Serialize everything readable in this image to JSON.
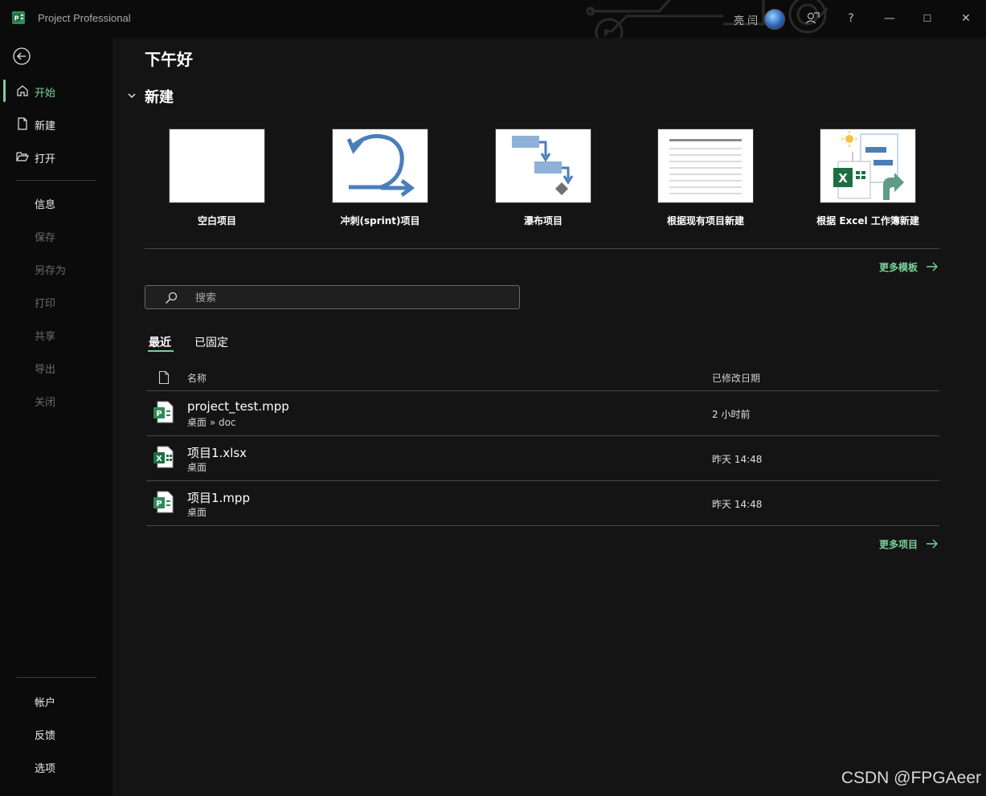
{
  "window": {
    "app_title": "Project Professional",
    "user_name": "亮 闫",
    "help_label": "?",
    "minimize_glyph": "—",
    "maximize_glyph": "☐",
    "close_glyph": "✕"
  },
  "sidebar": {
    "back_icon": "back-arrow-icon",
    "top_items": [
      {
        "label": "开始",
        "icon": "home-icon",
        "active": true
      },
      {
        "label": "新建",
        "icon": "new-document-icon"
      },
      {
        "label": "打开",
        "icon": "open-folder-icon"
      }
    ],
    "mid_items": [
      {
        "label": "信息"
      },
      {
        "label": "保存",
        "disabled": true
      },
      {
        "label": "另存为",
        "disabled": true
      },
      {
        "label": "打印",
        "disabled": true
      },
      {
        "label": "共享",
        "disabled": true
      },
      {
        "label": "导出",
        "disabled": true
      },
      {
        "label": "关闭",
        "disabled": true
      }
    ],
    "bottom_items": [
      {
        "label": "帐户"
      },
      {
        "label": "反馈"
      },
      {
        "label": "选项"
      }
    ]
  },
  "main": {
    "greeting": "下午好",
    "new_section": {
      "heading": "新建",
      "templates": [
        {
          "label": "空白项目",
          "icon": "blank-project-thumbnail"
        },
        {
          "label": "冲刺(sprint)项目",
          "icon": "sprint-cycle-thumbnail"
        },
        {
          "label": "瀑布项目",
          "icon": "waterfall-thumbnail"
        },
        {
          "label": "根据现有项目新建",
          "icon": "existing-project-thumbnail"
        },
        {
          "label": "根据 Excel 工作簿新建",
          "icon": "excel-import-thumbnail"
        }
      ],
      "more_templates": "更多模板"
    },
    "search": {
      "placeholder": "搜索"
    },
    "tabs": [
      {
        "label": "最近",
        "active": true
      },
      {
        "label": "已固定"
      }
    ],
    "file_list": {
      "columns": {
        "name": "名称",
        "modified": "已修改日期"
      },
      "rows": [
        {
          "name": "project_test.mpp",
          "path": "桌面 » doc",
          "modified": "2 小时前",
          "type": "project"
        },
        {
          "name": "项目1.xlsx",
          "path": "桌面",
          "modified": "昨天 14:48",
          "type": "excel"
        },
        {
          "name": "项目1.mpp",
          "path": "桌面",
          "modified": "昨天 14:48",
          "type": "project"
        }
      ],
      "more_items": "更多项目"
    }
  },
  "watermark": "CSDN @FPGAeer",
  "colors": {
    "accent_green": "#7ad19a",
    "sidebar_bg": "#0b0b0b",
    "main_bg": "#141414",
    "project_green": "#2e8b57",
    "excel_green": "#1d6f42",
    "template_blue": "#4a7ebb"
  }
}
